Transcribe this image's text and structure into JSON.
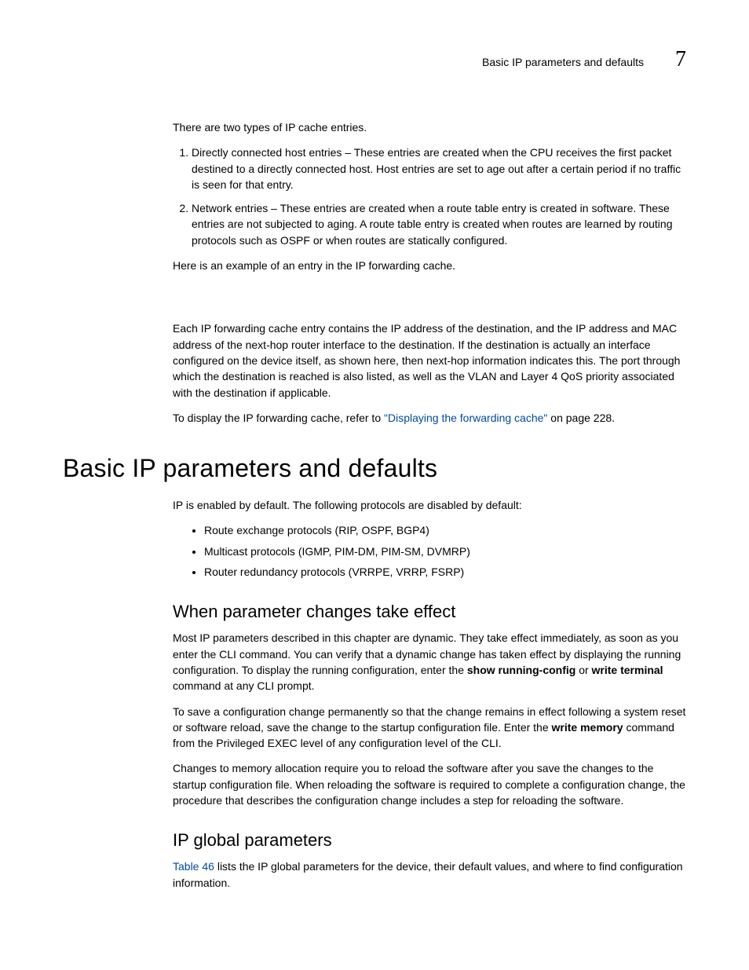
{
  "header": {
    "running_title": "Basic IP parameters and defaults",
    "chapter_number": "7"
  },
  "intro": {
    "p1": "There are two types of IP cache entries.",
    "list": {
      "item1": "Directly connected host entries –  These entries are created when the CPU receives the first packet destined to a directly connected host. Host entries are set to age out after a certain period if no traffic is seen for that entry.",
      "item2": "Network entries – These entries are created when a route table entry is created in software. These entries are not subjected to aging. A route table entry is created when routes are learned by routing protocols such as OSPF or when routes are statically configured."
    },
    "p2": "Here is an example of an entry in the IP forwarding cache.",
    "p3": "Each IP forwarding cache entry contains the IP address of the destination, and the IP address and MAC address of the next-hop router interface to the destination. If the destination is actually an interface configured on the device itself, as shown here, then next-hop information indicates this. The port through which the destination is reached is also listed, as well as the VLAN and Layer 4 QoS priority associated with the destination if applicable.",
    "p4_pre": "To display the IP forwarding cache, refer to ",
    "p4_link": "\"Displaying the forwarding cache\"",
    "p4_post": " on page 228."
  },
  "section": {
    "title": "Basic IP parameters and defaults",
    "p1": "IP is enabled by default.  The following protocols are disabled by default:",
    "bullets": {
      "b1": "Route exchange protocols (RIP, OSPF, BGP4)",
      "b2": "Multicast protocols (IGMP, PIM-DM, PIM-SM, DVMRP)",
      "b3": "Router redundancy protocols (VRRPE, VRRP, FSRP)"
    },
    "sub1": {
      "title": "When parameter changes take effect",
      "p1_a": "Most IP parameters described in this chapter are dynamic. They take effect immediately, as soon as you enter the CLI command.  You can verify that a dynamic change has taken effect by displaying the running configuration.  To display the running configuration, enter the ",
      "p1_bold1": "show running-config",
      "p1_b": " or ",
      "p1_bold2": "write terminal",
      "p1_c": " command at any CLI prompt.",
      "p2_a": "To save a configuration change permanently so that the change remains in effect following a system reset or software reload, save the change to the startup configuration file.  Enter the ",
      "p2_bold1": "write memory",
      "p2_b": " command from the Privileged EXEC level of any configuration level of the CLI.",
      "p3": "Changes to memory allocation require you to reload the software after you save the changes to the startup configuration file.  When reloading the software is required to complete a configuration change, the procedure that describes the configuration change includes a step for reloading the software."
    },
    "sub2": {
      "title": "IP global parameters",
      "p1_link": "Table 46",
      "p1_rest": " lists the IP global parameters for the device, their default values, and where to find configuration information."
    }
  }
}
